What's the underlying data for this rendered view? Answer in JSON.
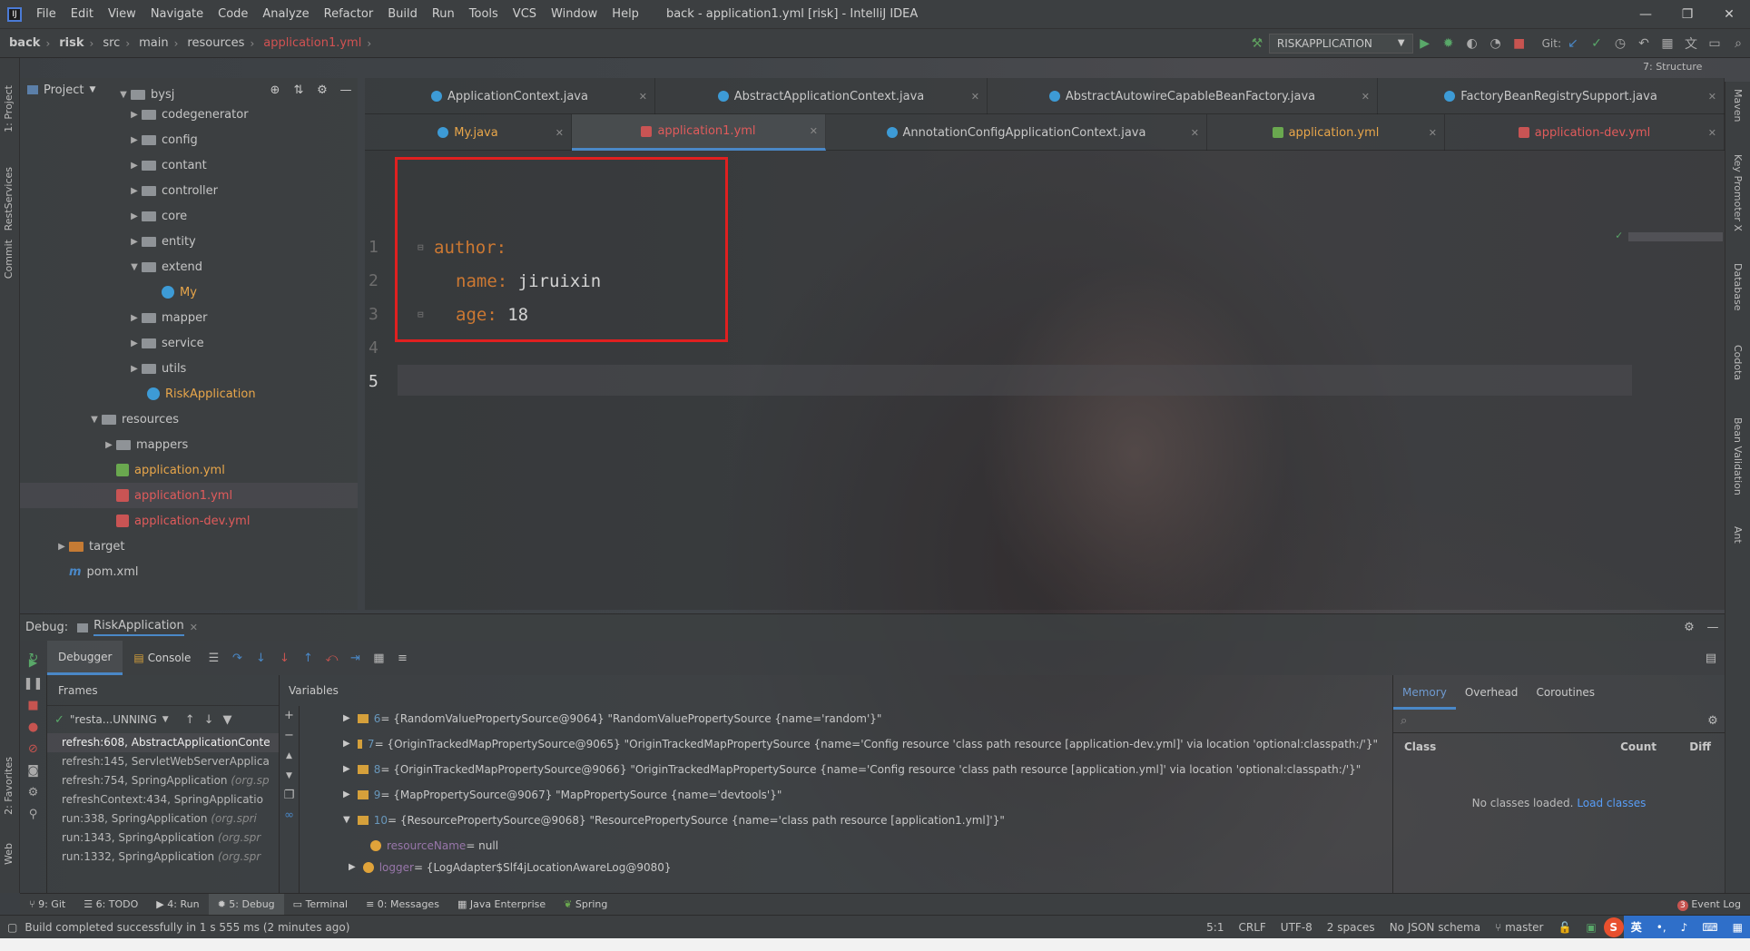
{
  "window": {
    "title": "back - application1.yml [risk] - IntelliJ IDEA",
    "logo_text": "IJ",
    "controls": {
      "minimize": "—",
      "maximize": "❐",
      "close": "✕"
    }
  },
  "menu": [
    "File",
    "Edit",
    "View",
    "Navigate",
    "Code",
    "Analyze",
    "Refactor",
    "Build",
    "Run",
    "Tools",
    "VCS",
    "Window",
    "Help"
  ],
  "breadcrumb": [
    "back",
    "risk",
    "src",
    "main",
    "resources",
    "application1.yml"
  ],
  "toolbar": {
    "run_config": "RISKAPPLICATION",
    "git_label": "Git:",
    "structure_tab": "7: Structure"
  },
  "left_stripe": [
    "1: Project",
    "RestServices",
    "Commit",
    "2: Favorites",
    "Web"
  ],
  "right_stripe": [
    "Maven",
    "Key Promoter X",
    "Database",
    "Codota",
    "Bean Validation",
    "Ant"
  ],
  "project": {
    "header": "Project",
    "tree": [
      {
        "label": "bysj",
        "kind": "folder",
        "open": true
      },
      {
        "label": "codegenerator",
        "kind": "folder",
        "open": false
      },
      {
        "label": "config",
        "kind": "folder",
        "open": false
      },
      {
        "label": "contant",
        "kind": "folder",
        "open": false
      },
      {
        "label": "controller",
        "kind": "folder",
        "open": false
      },
      {
        "label": "core",
        "kind": "folder",
        "open": false
      },
      {
        "label": "entity",
        "kind": "folder",
        "open": false
      },
      {
        "label": "extend",
        "kind": "folder",
        "open": true
      },
      {
        "label": "My",
        "kind": "class"
      },
      {
        "label": "mapper",
        "kind": "folder",
        "open": false
      },
      {
        "label": "service",
        "kind": "folder",
        "open": false
      },
      {
        "label": "utils",
        "kind": "folder",
        "open": false
      },
      {
        "label": "RiskApplication",
        "kind": "class"
      },
      {
        "label": "resources",
        "kind": "folder",
        "open": true
      },
      {
        "label": "mappers",
        "kind": "folder",
        "open": false
      },
      {
        "label": "application.yml",
        "kind": "yml"
      },
      {
        "label": "application1.yml",
        "kind": "yml-red"
      },
      {
        "label": "application-dev.yml",
        "kind": "yml-red"
      },
      {
        "label": "target",
        "kind": "folder-orange",
        "open": false
      },
      {
        "label": "pom.xml",
        "kind": "xml"
      }
    ]
  },
  "editor": {
    "tabs_row1": [
      "ApplicationContext.java",
      "AbstractApplicationContext.java",
      "AbstractAutowireCapableBeanFactory.java",
      "FactoryBeanRegistrySupport.java"
    ],
    "tabs_row2": [
      "My.java",
      "application1.yml",
      "AnnotationConfigApplicationContext.java",
      "application.yml",
      "application-dev.yml"
    ],
    "line_numbers": [
      "1",
      "2",
      "3",
      "4",
      "5"
    ],
    "code": {
      "l1_key": "author",
      "l2_key": "name",
      "l2_val": "jiruixin",
      "l3_key": "age",
      "l3_val": "18"
    }
  },
  "debug": {
    "label": "Debug:",
    "run_tab": "RiskApplication",
    "tabs": [
      "Debugger",
      "Console"
    ],
    "frames_title": "Frames",
    "thread": "\"resta...UNNING",
    "frames": [
      {
        "method": "refresh:608, AbstractApplicationConte",
        "cls": ""
      },
      {
        "method": "refresh:145, ServletWebServerApplica",
        "cls": ""
      },
      {
        "method": "refresh:754, SpringApplication",
        "cls": "(org.sp"
      },
      {
        "method": "refreshContext:434, SpringApplicatio",
        "cls": ""
      },
      {
        "method": "run:338, SpringApplication",
        "cls": "(org.spri"
      },
      {
        "method": "run:1343, SpringApplication",
        "cls": "(org.spr"
      },
      {
        "method": "run:1332, SpringApplication",
        "cls": "(org.spr"
      }
    ],
    "variables_title": "Variables",
    "variables": [
      {
        "idx": "6",
        "text": " = {RandomValuePropertySource@9064} \"RandomValuePropertySource {name='random'}\""
      },
      {
        "idx": "7",
        "text": " = {OriginTrackedMapPropertySource@9065} \"OriginTrackedMapPropertySource {name='Config resource 'class path resource [application-dev.yml]' via location 'optional:classpath:/'}\""
      },
      {
        "idx": "8",
        "text": " = {OriginTrackedMapPropertySource@9066} \"OriginTrackedMapPropertySource {name='Config resource 'class path resource [application.yml]' via location 'optional:classpath:/'}\""
      },
      {
        "idx": "9",
        "text": " = {MapPropertySource@9067} \"MapPropertySource {name='devtools'}\""
      },
      {
        "idx": "10",
        "text": " = {ResourcePropertySource@9068} \"ResourcePropertySource {name='class path resource [application1.yml]'}\""
      }
    ],
    "fields": [
      {
        "name": "resourceName",
        "text": " = null"
      },
      {
        "name": "logger",
        "text": " = {LogAdapter$Slf4jLocationAwareLog@9080}"
      }
    ],
    "memory_tabs": [
      "Memory",
      "Overhead",
      "Coroutines"
    ],
    "memory_columns": [
      "Class",
      "Count",
      "Diff"
    ],
    "memory_empty": "No classes loaded.",
    "memory_link": "Load classes"
  },
  "bottom_tabs": [
    "9: Git",
    "6: TODO",
    "4: Run",
    "5: Debug",
    "Terminal",
    "0: Messages",
    "Java Enterprise",
    "Spring",
    "Event Log"
  ],
  "status": {
    "message": "Build completed successfully in 1 s 555 ms (2 minutes ago)",
    "position": "5:1",
    "line_sep": "CRLF",
    "encoding": "UTF-8",
    "indent": "2 spaces",
    "schema": "No JSON schema",
    "branch": "master",
    "event_count": "3",
    "ime": "英"
  },
  "colors": {
    "accent": "#4a88c7",
    "highlight_box": "#e02020",
    "yaml_key": "#cc7832"
  }
}
